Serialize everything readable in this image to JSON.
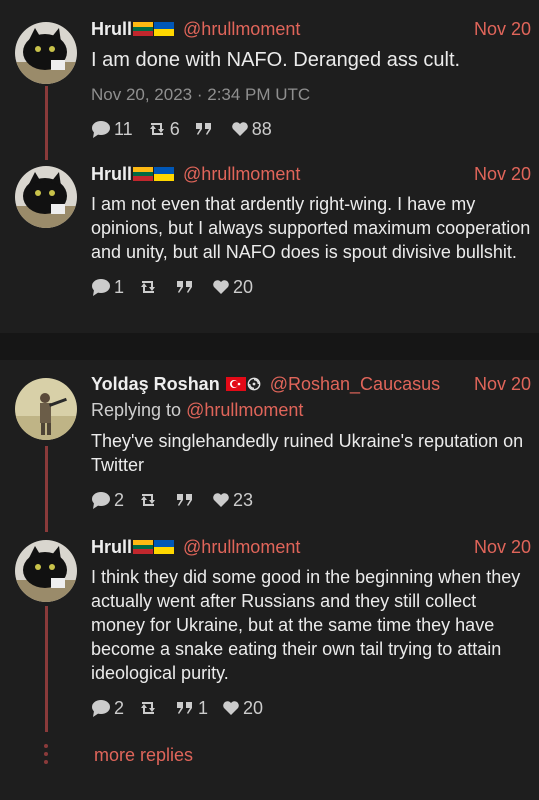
{
  "thread1": {
    "tweet1": {
      "name": "Hrull",
      "handle": "@hrullmoment",
      "date": "Nov 20",
      "text": "I am done with NAFO. Deranged ass cult.",
      "full_date": "Nov 20, 2023 · 2:34 PM UTC",
      "replies": "11",
      "retweets": "6",
      "quotes": "",
      "likes": "88"
    },
    "tweet2": {
      "name": "Hrull",
      "handle": "@hrullmoment",
      "date": "Nov 20",
      "text": "I am not even that ardently right-wing. I have my opinions, but I always supported maximum cooperation and unity, but all NAFO does is spout divisive bullshit.",
      "replies": "1",
      "retweets": "",
      "quotes": "",
      "likes": "20"
    }
  },
  "thread2": {
    "tweet1": {
      "name": "Yoldaş Roshan",
      "handle": "@Roshan_Caucasus",
      "date": "Nov 20",
      "replying_prefix": "Replying to",
      "replying_handle": "@hrullmoment",
      "text": "They've singlehandedly ruined Ukraine's reputation on Twitter",
      "replies": "2",
      "retweets": "",
      "quotes": "",
      "likes": "23"
    },
    "tweet2": {
      "name": "Hrull",
      "handle": "@hrullmoment",
      "date": "Nov 20",
      "text": "I think they did some good in the beginning when they actually went after Russians and they still collect money for Ukraine, but at the same time they have become a snake eating their own tail trying to attain ideological purity.",
      "replies": "2",
      "retweets": "",
      "quotes": "1",
      "likes": "20"
    },
    "more_replies": "more replies"
  },
  "colors": {
    "accent": "#e0655a",
    "thread_line": "#8a3a3a",
    "background": "#161616",
    "card": "#1e1e1e"
  },
  "icons": [
    "comment-icon",
    "retweet-icon",
    "quote-icon",
    "heart-icon",
    "lithuania-flag-icon",
    "ukraine-flag-icon",
    "turkey-flag-icon",
    "spiral-symbol-icon"
  ]
}
